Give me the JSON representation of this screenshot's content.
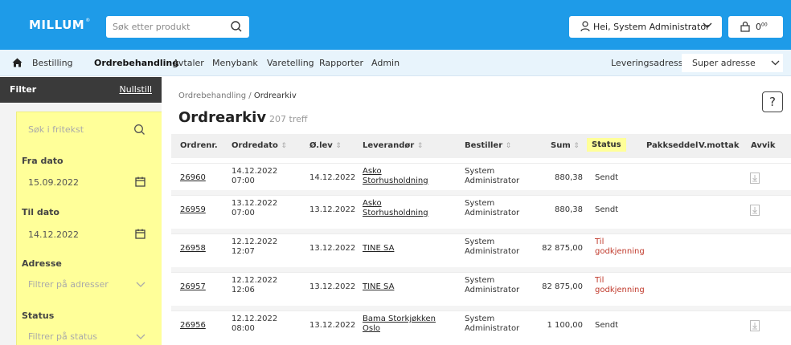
{
  "header": {
    "logo": "MILLUM",
    "logo_mark": "®",
    "search_placeholder": "Søk etter produkt",
    "user_greeting": "Hei, System Administrator",
    "cart_count": "0",
    "cart_decimals": "00",
    "brand_color": "#1e9be8"
  },
  "nav": {
    "items": [
      "Bestilling",
      "Ordrebehandling",
      "Avtaler",
      "Menybank",
      "Varetelling",
      "Rapporter",
      "Admin"
    ],
    "active": "Ordrebehandling",
    "delivery_label": "Leveringsadresse",
    "delivery_value": "Super adresse"
  },
  "filter": {
    "title": "Filter",
    "reset": "Nullstill",
    "search_placeholder": "Søk i fritekst",
    "from_label": "Fra dato",
    "from_value": "15.09.2022",
    "to_label": "Til dato",
    "to_value": "14.12.2022",
    "address_label": "Adresse",
    "address_placeholder": "Filtrer på adresser",
    "status_label": "Status",
    "status_placeholder": "Filtrer på status",
    "highlight_color": "#ffff99"
  },
  "main": {
    "breadcrumb_parent": "Ordrebehandling",
    "breadcrumb_sep": " / ",
    "breadcrumb_current": "Ordrearkiv",
    "title": "Ordrearkiv",
    "count": "207 treff",
    "help": "?"
  },
  "table": {
    "headers": {
      "ordernr": "Ordrenr.",
      "orderdate": "Ordredato",
      "delivery": "Ø.lev",
      "supplier": "Leverandør",
      "orderer": "Bestiller",
      "sum": "Sum",
      "status": "Status",
      "packslip": "Pakkseddel",
      "received": "V.mottak",
      "deviation": "Avvik"
    },
    "rows": [
      {
        "nr": "26960",
        "date1": "14.12.2022",
        "date2": "07:00",
        "lev": "14.12.2022",
        "sup1": "Asko",
        "sup2": "Storhusholdning",
        "by1": "System",
        "by2": "Administrator",
        "sum": "880,38",
        "st1": "Sendt",
        "st2": "",
        "red": false,
        "pdf": true
      },
      {
        "nr": "26959",
        "date1": "13.12.2022",
        "date2": "07:00",
        "lev": "13.12.2022",
        "sup1": "Asko",
        "sup2": "Storhusholdning",
        "by1": "System",
        "by2": "Administrator",
        "sum": "880,38",
        "st1": "Sendt",
        "st2": "",
        "red": false,
        "pdf": true
      },
      {
        "nr": "26958",
        "date1": "12.12.2022",
        "date2": "12:07",
        "lev": "13.12.2022",
        "sup1": "TINE SA",
        "sup2": "",
        "by1": "System",
        "by2": "Administrator",
        "sum": "82 875,00",
        "st1": "Til",
        "st2": "godkjenning",
        "red": true,
        "pdf": false
      },
      {
        "nr": "26957",
        "date1": "12.12.2022",
        "date2": "12:06",
        "lev": "13.12.2022",
        "sup1": "TINE SA",
        "sup2": "",
        "by1": "System",
        "by2": "Administrator",
        "sum": "82 875,00",
        "st1": "Til",
        "st2": "godkjenning",
        "red": true,
        "pdf": false
      },
      {
        "nr": "26956",
        "date1": "12.12.2022",
        "date2": "08:00",
        "lev": "13.12.2022",
        "sup1": "Bama Storkjøkken",
        "sup2": "Oslo",
        "by1": "System",
        "by2": "Administrator",
        "sum": "1 100,00",
        "st1": "Sendt",
        "st2": "",
        "red": false,
        "pdf": true
      }
    ]
  }
}
